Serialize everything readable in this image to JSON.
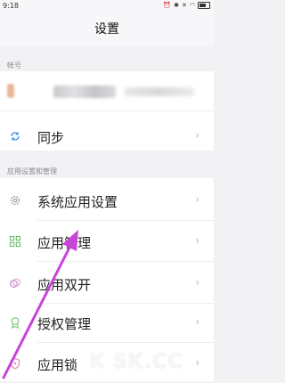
{
  "status_bar": {
    "time": "9:18",
    "icons": [
      "alarm-icon",
      "bluetooth-icon",
      "mute-icon",
      "wifi-icon",
      "battery-icon"
    ]
  },
  "header": {
    "title": "设置"
  },
  "account_section": {
    "label": "帐号"
  },
  "settings_section": {
    "label": "应用设置和管理"
  },
  "rows": [
    {
      "name": "同步",
      "icon": "sync-icon"
    },
    {
      "name": "系统应用设置",
      "icon": "gear-icon"
    },
    {
      "name": "应用管理",
      "icon": "grid-icon"
    },
    {
      "name": "应用双开",
      "icon": "dual-app-icon"
    },
    {
      "name": "授权管理",
      "icon": "badge-icon"
    },
    {
      "name": "应用锁",
      "icon": "shield-lock-icon"
    }
  ],
  "watermark": "K SK.CC",
  "colors": {
    "accent_arrow": "#c744d8",
    "icon_sync": "#3b8ff2",
    "icon_grid": "#6bbf6b",
    "icon_dual": "#b58be0",
    "icon_badge": "#7cc77a",
    "icon_shield": "#e08ab0"
  }
}
